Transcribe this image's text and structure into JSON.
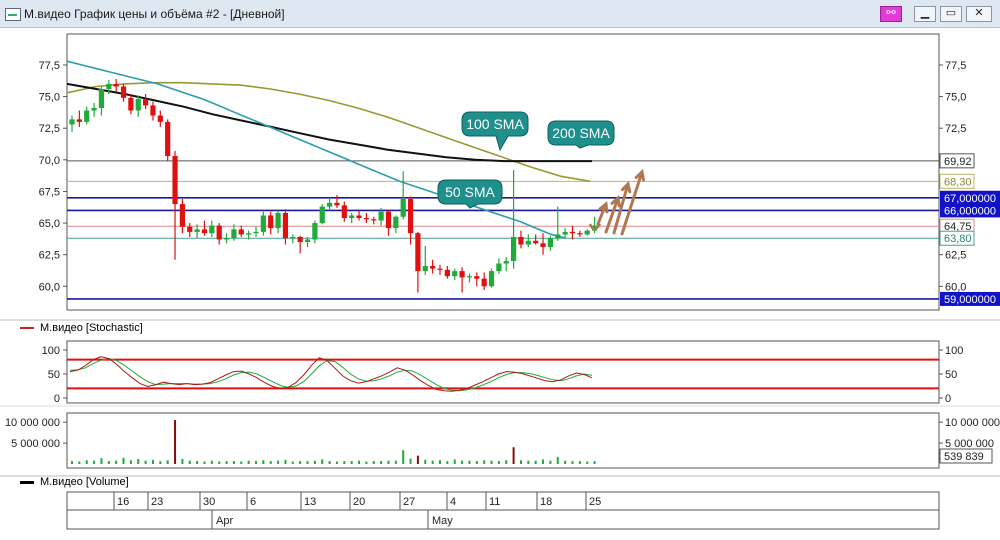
{
  "window": {
    "title": "М.видео График цены и объёма #2 - [Дневной]"
  },
  "colors": {
    "up": "#1faa3a",
    "down": "#e01010",
    "sma50": "#2a9db0",
    "sma100": "#111111",
    "sma200": "#999933"
  },
  "chart_data": [
    {
      "type": "candlestick",
      "name": "price",
      "ylim": [
        58.6,
        79.0
      ],
      "yticks": [
        "77,5",
        "75,0",
        "72,5",
        "70,0",
        "67,5",
        "65,0",
        "62,5",
        "60,0"
      ],
      "right_labels": [
        "77,5",
        "75,0",
        "72,5",
        "62,5",
        "60,0"
      ],
      "ohlc": [
        [
          72.8,
          73.5,
          72.2,
          73.2
        ],
        [
          73.2,
          73.9,
          72.6,
          73.0
        ],
        [
          73.0,
          74.2,
          72.8,
          73.9
        ],
        [
          73.9,
          74.5,
          73.4,
          74.1
        ],
        [
          74.1,
          75.8,
          73.5,
          75.6
        ],
        [
          75.6,
          76.3,
          75.2,
          76.0
        ],
        [
          76.0,
          76.4,
          75.4,
          75.8
        ],
        [
          75.8,
          76.0,
          74.6,
          74.9
        ],
        [
          74.9,
          75.2,
          73.6,
          73.9
        ],
        [
          73.9,
          75.1,
          73.4,
          74.8
        ],
        [
          74.8,
          75.2,
          74.0,
          74.3
        ],
        [
          74.3,
          74.6,
          73.1,
          73.5
        ],
        [
          73.5,
          73.9,
          72.6,
          73.0
        ],
        [
          73.0,
          73.2,
          69.9,
          70.3
        ],
        [
          70.3,
          70.7,
          62.1,
          66.5
        ],
        [
          66.5,
          66.9,
          64.2,
          64.7
        ],
        [
          64.7,
          65.0,
          63.9,
          64.3
        ],
        [
          64.3,
          64.9,
          63.8,
          64.5
        ],
        [
          64.5,
          65.2,
          64.0,
          64.2
        ],
        [
          64.2,
          65.2,
          63.9,
          64.8
        ],
        [
          64.8,
          65.0,
          63.3,
          63.7
        ],
        [
          63.7,
          64.2,
          63.4,
          63.8
        ],
        [
          63.8,
          64.9,
          63.6,
          64.5
        ],
        [
          64.5,
          64.8,
          63.9,
          64.1
        ],
        [
          64.1,
          64.4,
          63.7,
          64.2
        ],
        [
          64.2,
          64.7,
          63.9,
          64.3
        ],
        [
          64.3,
          65.9,
          64.0,
          65.6
        ],
        [
          65.6,
          65.9,
          64.1,
          64.6
        ],
        [
          64.6,
          66.0,
          64.2,
          65.8
        ],
        [
          65.8,
          66.1,
          63.3,
          63.8
        ],
        [
          63.8,
          64.1,
          63.4,
          63.9
        ],
        [
          63.9,
          64.0,
          62.6,
          63.5
        ],
        [
          63.5,
          63.9,
          63.1,
          63.7
        ],
        [
          63.7,
          65.2,
          63.4,
          65.0
        ],
        [
          65.0,
          66.5,
          64.9,
          66.3
        ],
        [
          66.3,
          67.0,
          66.0,
          66.6
        ],
        [
          66.6,
          67.2,
          66.2,
          66.4
        ],
        [
          66.4,
          66.7,
          65.1,
          65.4
        ],
        [
          65.4,
          65.8,
          65.0,
          65.6
        ],
        [
          65.6,
          66.0,
          65.2,
          65.4
        ],
        [
          65.4,
          65.8,
          65.0,
          65.3
        ],
        [
          65.3,
          65.5,
          64.9,
          65.2
        ],
        [
          65.2,
          66.2,
          64.8,
          65.9
        ],
        [
          65.9,
          66.0,
          64.0,
          64.6
        ],
        [
          64.6,
          65.6,
          64.2,
          65.5
        ],
        [
          65.5,
          69.1,
          65.3,
          66.9
        ],
        [
          66.9,
          67.1,
          63.3,
          64.2
        ],
        [
          64.2,
          64.3,
          59.5,
          61.2
        ],
        [
          61.2,
          63.2,
          60.9,
          61.6
        ],
        [
          61.6,
          62.1,
          61.0,
          61.4
        ],
        [
          61.4,
          61.7,
          60.9,
          61.3
        ],
        [
          61.3,
          61.6,
          60.6,
          60.8
        ],
        [
          60.8,
          61.4,
          60.5,
          61.2
        ],
        [
          61.2,
          61.5,
          59.5,
          60.7
        ],
        [
          60.7,
          61.0,
          60.3,
          60.8
        ],
        [
          60.8,
          61.1,
          60.0,
          60.6
        ],
        [
          60.6,
          61.1,
          59.7,
          60.0
        ],
        [
          60.0,
          61.4,
          59.9,
          61.2
        ],
        [
          61.2,
          62.2,
          61.0,
          61.8
        ],
        [
          61.8,
          62.3,
          61.2,
          62.0
        ],
        [
          62.0,
          69.2,
          61.4,
          63.9
        ],
        [
          63.9,
          64.4,
          63.0,
          63.3
        ],
        [
          63.3,
          64.1,
          63.1,
          63.6
        ],
        [
          63.6,
          64.1,
          63.3,
          63.4
        ],
        [
          63.4,
          64.2,
          62.5,
          63.1
        ],
        [
          63.1,
          64.0,
          62.8,
          63.8
        ],
        [
          63.8,
          66.3,
          63.6,
          64.1
        ],
        [
          64.1,
          64.6,
          63.9,
          64.3
        ],
        [
          64.3,
          64.8,
          63.7,
          64.2
        ],
        [
          64.2,
          64.4,
          63.9,
          64.1
        ],
        [
          64.1,
          64.5,
          64.0,
          64.4
        ],
        [
          64.4,
          65.5,
          64.2,
          64.8
        ]
      ],
      "sma50": [
        77.8,
        77.5,
        77.2,
        76.9,
        76.6,
        76.3,
        76.0,
        75.6,
        75.2,
        74.8,
        74.3,
        73.8,
        73.3,
        72.8,
        72.3,
        71.8,
        71.3,
        70.8,
        70.3,
        69.8,
        69.3,
        68.8,
        68.3,
        67.9,
        67.5,
        67.1,
        66.7,
        66.3,
        65.9,
        65.5,
        65.1,
        64.6,
        64.1,
        63.8
      ],
      "sma100": [
        76.0,
        75.6,
        75.2,
        74.7,
        74.2,
        73.6,
        73.1,
        72.6,
        72.1,
        71.6,
        71.2,
        70.8,
        70.5,
        70.2,
        70.0,
        69.9,
        69.9,
        69.9,
        69.9
      ],
      "sma200": [
        75.3,
        75.8,
        76.0,
        76.1,
        76.1,
        76.0,
        75.9,
        75.6,
        75.2,
        74.7,
        74.1,
        73.4,
        72.6,
        71.8,
        71.0,
        70.2,
        69.4,
        68.7,
        68.3
      ],
      "hlines": [
        {
          "value": 69.92,
          "color": "#555555",
          "label": "69,92",
          "badge": false
        },
        {
          "value": 68.3,
          "color": "#b7b76a",
          "label": "68,30",
          "badge": false
        },
        {
          "value": 67.0,
          "color": "#1a1a9a",
          "label": "67,000000",
          "badge": true
        },
        {
          "value": 66.0,
          "color": "#1a1a9a",
          "label": "66,000000",
          "badge": true
        },
        {
          "value": 64.75,
          "color": "#d98a8a",
          "label": "64,75",
          "badge": false
        },
        {
          "value": 63.8,
          "color": "#4aa090",
          "label": "63,80",
          "badge": false
        },
        {
          "value": 59.0,
          "color": "#1a1a9a",
          "label": "59,000000",
          "badge": true
        }
      ],
      "annotations": [
        "50 SMA",
        "100 SMA",
        "200 SMA"
      ]
    },
    {
      "type": "line",
      "name": "М.видео [Stochastic]",
      "ylim": [
        0,
        100
      ],
      "yticks": [
        "100",
        "50",
        "0"
      ],
      "levels": [
        80,
        20
      ],
      "k": [
        55,
        58,
        68,
        80,
        86,
        82,
        70,
        55,
        42,
        30,
        24,
        28,
        33,
        30,
        28,
        30,
        28,
        29,
        32,
        40,
        48,
        55,
        56,
        50,
        42,
        32,
        24,
        20,
        22,
        32,
        48,
        68,
        84,
        78,
        62,
        46,
        36,
        31,
        34,
        40,
        46,
        54,
        63,
        58,
        48,
        36,
        26,
        18,
        15,
        14,
        16,
        20,
        27,
        34,
        42,
        50,
        55,
        54,
        51,
        46,
        41,
        36,
        34,
        38,
        46,
        52,
        49,
        42
      ],
      "d": [
        58,
        59,
        63,
        72,
        79,
        82,
        78,
        68,
        56,
        44,
        34,
        28,
        29,
        30,
        30,
        30,
        29,
        29,
        30,
        34,
        40,
        48,
        53,
        54,
        50,
        42,
        34,
        26,
        22,
        25,
        34,
        50,
        67,
        78,
        76,
        64,
        50,
        40,
        35,
        36,
        40,
        46,
        54,
        58,
        56,
        48,
        38,
        28,
        20,
        16,
        15,
        17,
        21,
        27,
        34,
        42,
        49,
        53,
        53,
        51,
        47,
        42,
        38,
        36,
        40,
        46,
        50,
        47
      ]
    },
    {
      "type": "bar",
      "name": "М.видео [Volume]",
      "yticks": [
        "10 000 000",
        "5 000 000"
      ],
      "last_value": "539 839",
      "values": [
        0.7,
        0.6,
        0.9,
        0.8,
        1.4,
        0.7,
        0.8,
        1.5,
        0.9,
        1.2,
        0.8,
        1.0,
        0.7,
        0.9,
        10.5,
        1.2,
        0.8,
        0.7,
        0.6,
        0.8,
        0.6,
        0.7,
        0.7,
        0.6,
        0.8,
        0.7,
        0.9,
        0.7,
        0.8,
        1.0,
        0.6,
        0.7,
        0.7,
        0.8,
        1.1,
        0.7,
        0.6,
        0.7,
        0.7,
        0.8,
        0.6,
        0.7,
        0.7,
        0.8,
        0.8,
        3.3,
        1.3,
        2.0,
        1.0,
        0.8,
        0.9,
        0.7,
        1.1,
        0.8,
        0.8,
        0.7,
        0.9,
        0.8,
        0.7,
        0.9,
        4.0,
        0.9,
        0.8,
        0.8,
        1.1,
        0.8,
        1.7,
        0.8,
        0.7,
        0.7,
        0.6,
        0.7
      ],
      "down": [
        14,
        47,
        60
      ]
    }
  ],
  "legends": {
    "stochastic": "М.видео [Stochastic]",
    "volume": "М.видео [Volume]"
  },
  "x_axis": {
    "days": [
      "16",
      "23",
      "30",
      "6",
      "13",
      "20",
      "27",
      "4",
      "11",
      "18",
      "25"
    ],
    "months": [
      "Apr",
      "May"
    ]
  },
  "right_axis": {
    "stoch": [
      "100",
      "50",
      "0"
    ],
    "volume": [
      "10 000 000",
      "5 000 000"
    ]
  }
}
